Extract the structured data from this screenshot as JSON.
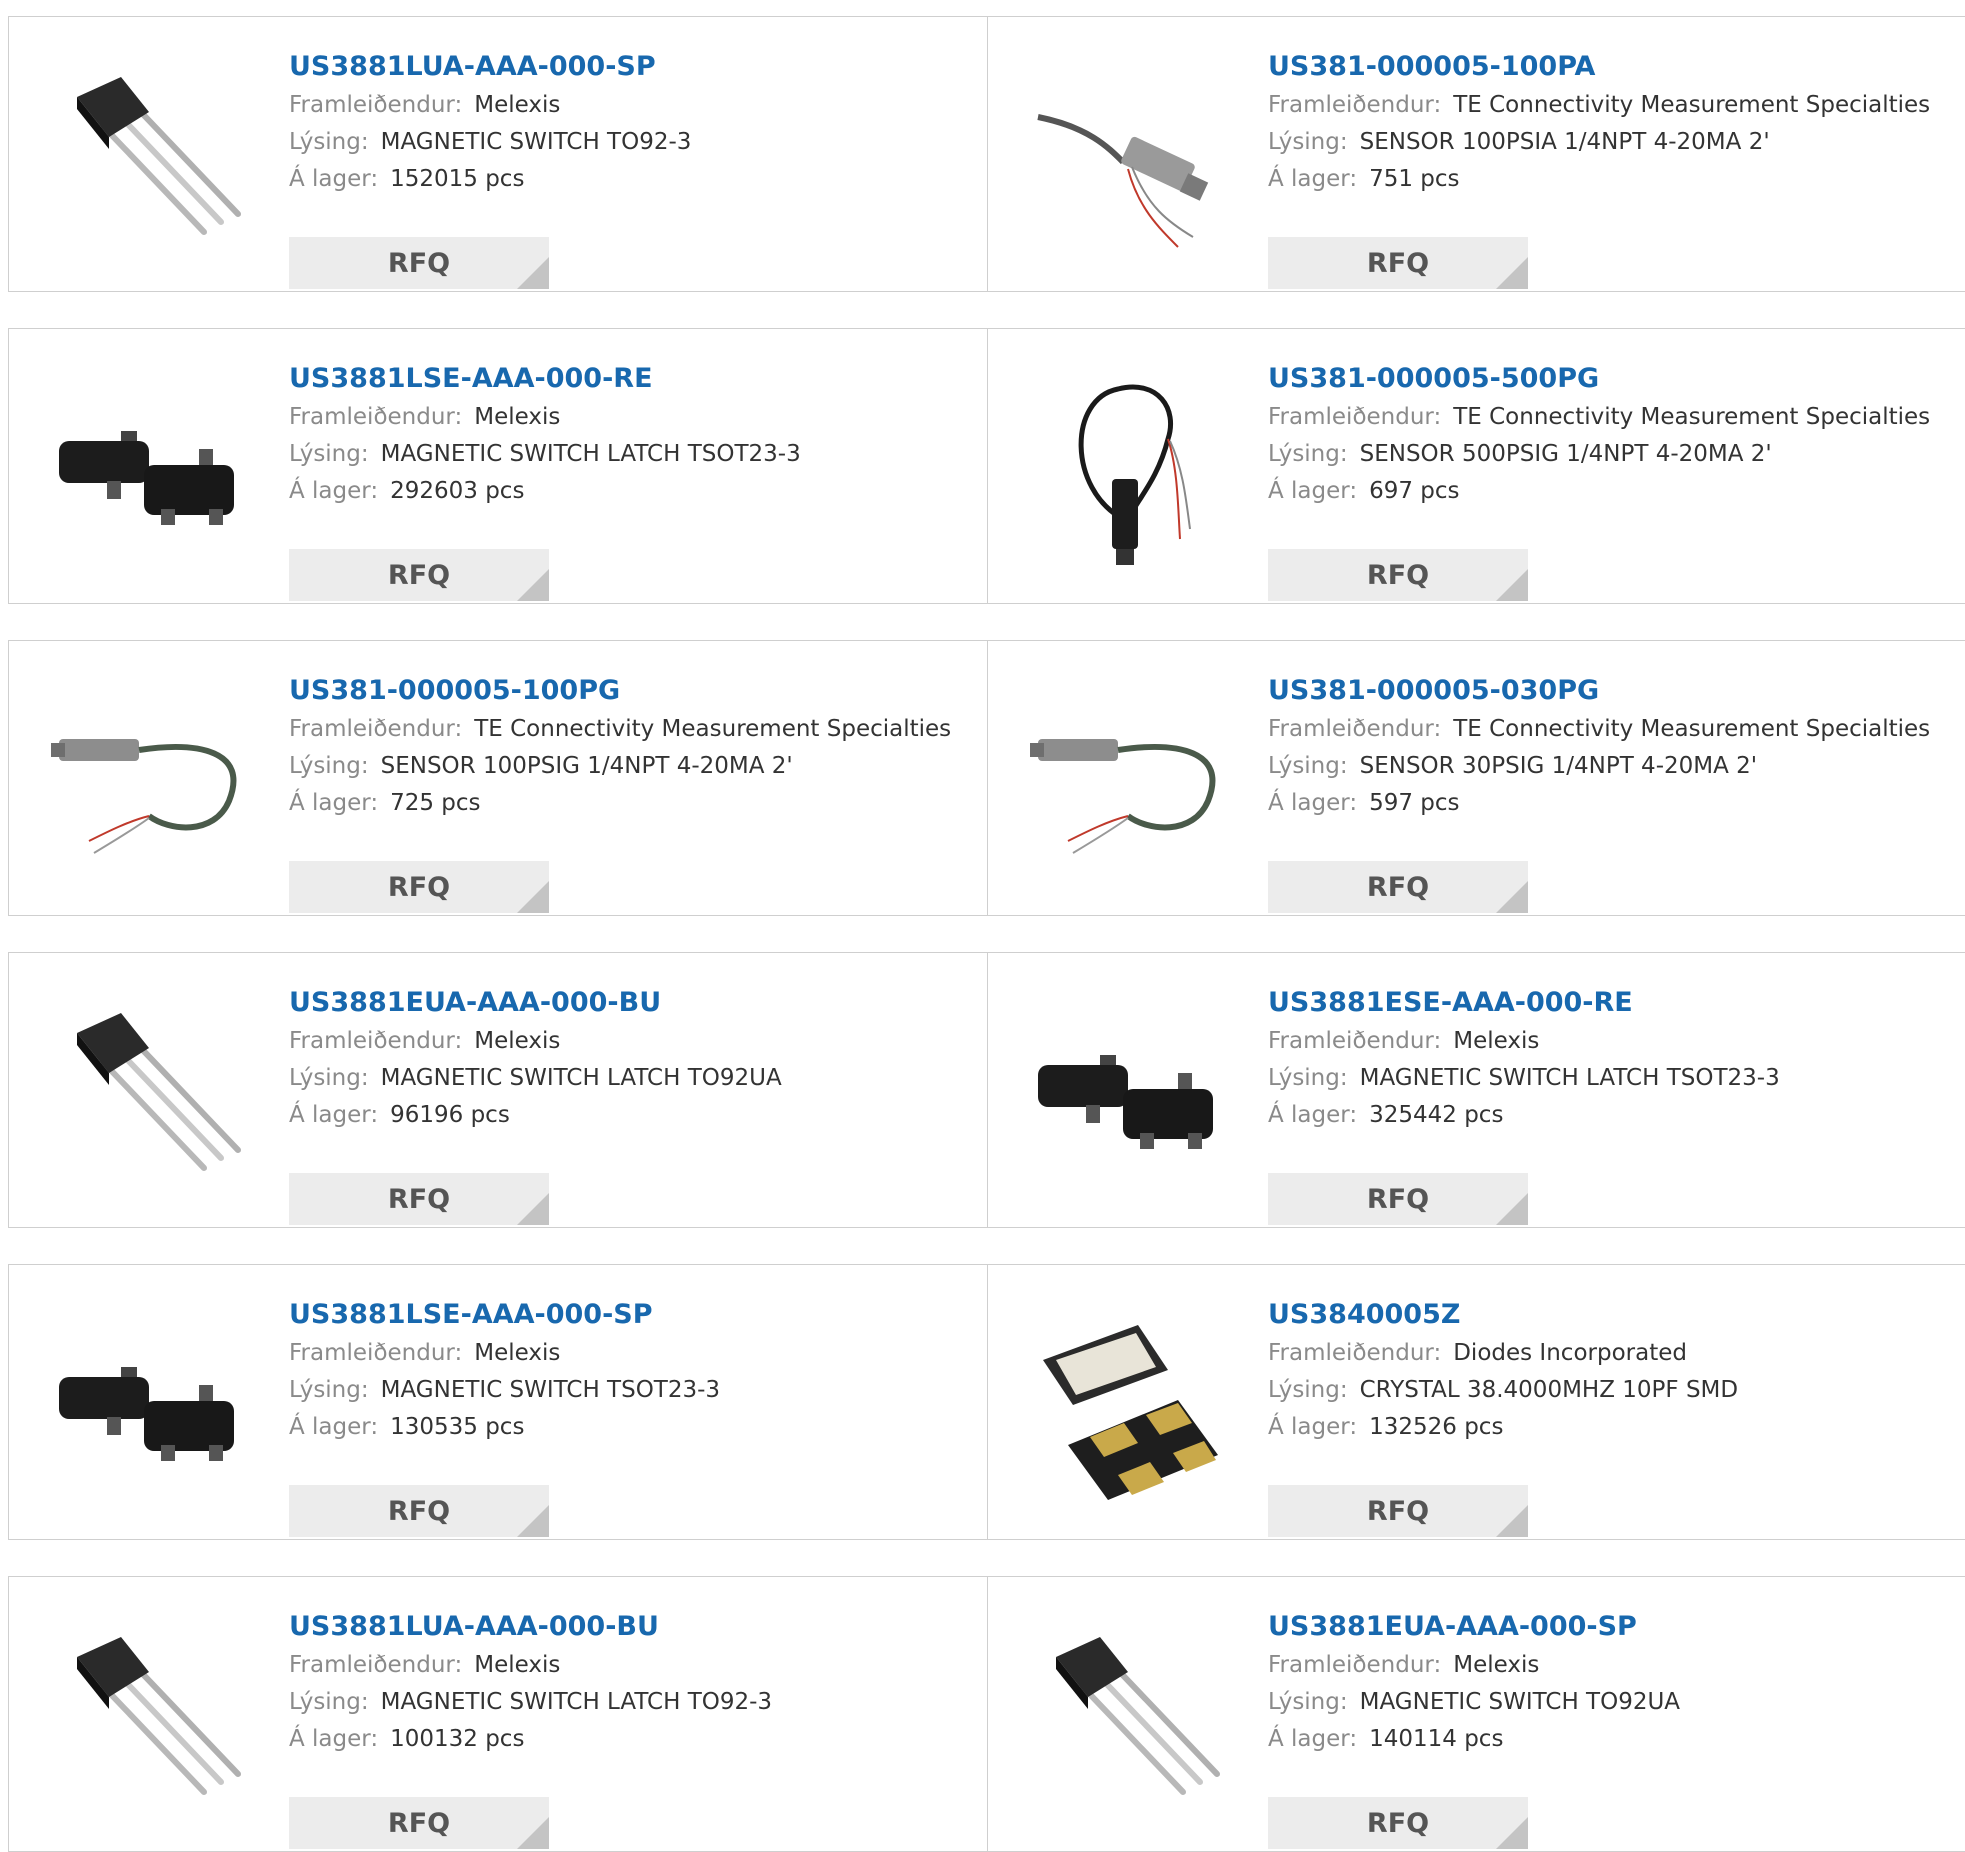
{
  "labels": {
    "manufacturer": "Framleiðendur:",
    "description": "Lýsing:",
    "stock": "Á lager:",
    "rfq": "RFQ"
  },
  "products": [
    {
      "part": "US3881LUA-AAA-000-SP",
      "manufacturer": "Melexis",
      "description": "MAGNETIC SWITCH TO92-3",
      "stock": "152015 pcs",
      "icon": "to92-icon"
    },
    {
      "part": "US381-000005-100PA",
      "manufacturer": "TE Connectivity Measurement Specialties",
      "description": "SENSOR 100PSIA 1/4NPT 4-20MA 2'",
      "stock": "751 pcs",
      "icon": "pressure-sensor-icon"
    },
    {
      "part": "US3881LSE-AAA-000-RE",
      "manufacturer": "Melexis",
      "description": "MAGNETIC SWITCH LATCH TSOT23-3",
      "stock": "292603 pcs",
      "icon": "tsot23-icon"
    },
    {
      "part": "US381-000005-500PG",
      "manufacturer": "TE Connectivity Measurement Specialties",
      "description": "SENSOR 500PSIG 1/4NPT 4-20MA 2'",
      "stock": "697 pcs",
      "icon": "pressure-sensor-vertical-icon"
    },
    {
      "part": "US381-000005-100PG",
      "manufacturer": "TE Connectivity Measurement Specialties",
      "description": "SENSOR 100PSIG 1/4NPT 4-20MA 2'",
      "stock": "725 pcs",
      "icon": "pressure-sensor-cable-icon"
    },
    {
      "part": "US381-000005-030PG",
      "manufacturer": "TE Connectivity Measurement Specialties",
      "description": "SENSOR 30PSIG 1/4NPT 4-20MA 2'",
      "stock": "597 pcs",
      "icon": "pressure-sensor-cable-icon"
    },
    {
      "part": "US3881EUA-AAA-000-BU",
      "manufacturer": "Melexis",
      "description": "MAGNETIC SWITCH LATCH TO92UA",
      "stock": "96196 pcs",
      "icon": "to92-icon"
    },
    {
      "part": "US3881ESE-AAA-000-RE",
      "manufacturer": "Melexis",
      "description": "MAGNETIC SWITCH LATCH TSOT23-3",
      "stock": "325442 pcs",
      "icon": "tsot23-icon"
    },
    {
      "part": "US3881LSE-AAA-000-SP",
      "manufacturer": "Melexis",
      "description": "MAGNETIC SWITCH TSOT23-3",
      "stock": "130535 pcs",
      "icon": "tsot23-icon"
    },
    {
      "part": "US3840005Z",
      "manufacturer": "Diodes Incorporated",
      "description": "CRYSTAL 38.4000MHZ 10PF SMD",
      "stock": "132526 pcs",
      "icon": "crystal-smd-icon"
    },
    {
      "part": "US3881LUA-AAA-000-BU",
      "manufacturer": "Melexis",
      "description": "MAGNETIC SWITCH LATCH TO92-3",
      "stock": "100132 pcs",
      "icon": "to92-icon"
    },
    {
      "part": "US3881EUA-AAA-000-SP",
      "manufacturer": "Melexis",
      "description": "MAGNETIC SWITCH TO92UA",
      "stock": "140114 pcs",
      "icon": "to92-icon"
    }
  ]
}
